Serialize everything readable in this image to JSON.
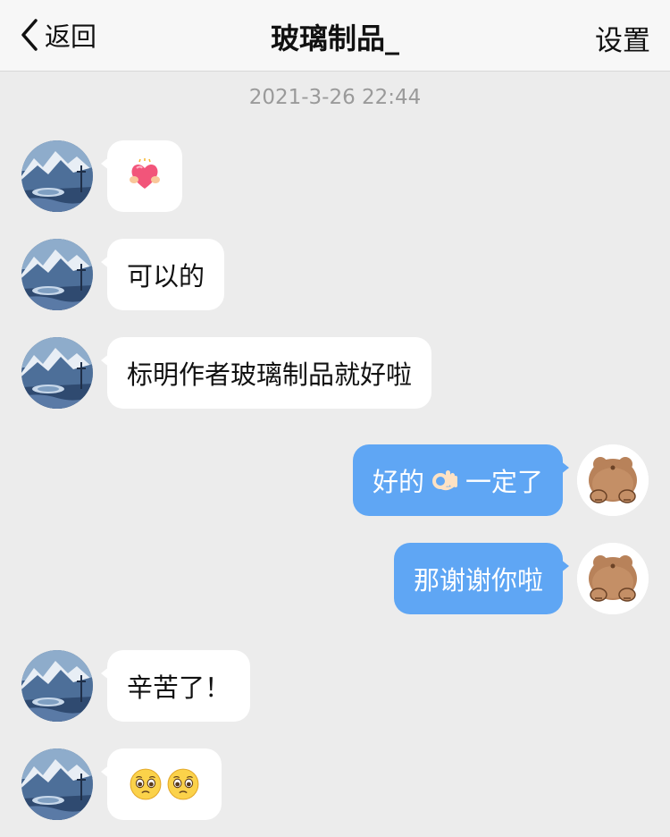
{
  "header": {
    "back_label": "返回",
    "title": "玻璃制品_",
    "settings_label": "设置"
  },
  "timestamp": "2021-3-26 22:44",
  "messages": [
    {
      "side": "in",
      "type": "emoji",
      "emoji": "heart-with-hands-sticker"
    },
    {
      "side": "in",
      "type": "text",
      "text": "可以的"
    },
    {
      "side": "in",
      "type": "text",
      "text": "标明作者玻璃制品就好啦"
    },
    {
      "side": "out",
      "type": "text",
      "text_before": "好的",
      "emoji": "ok-hand-emoji",
      "text_after": "一定了"
    },
    {
      "side": "out",
      "type": "text",
      "text": "那谢谢你啦"
    },
    {
      "side": "in",
      "type": "text",
      "text": "辛苦了！"
    },
    {
      "side": "in",
      "type": "emoji",
      "emoji": "pleading-face-emoji x2"
    }
  ],
  "colors": {
    "background": "#ececec",
    "incoming_bubble": "#ffffff",
    "outgoing_bubble": "#5fa6f4",
    "header": "#f7f7f7",
    "timestamp": "#9a9a9a"
  },
  "icons": {
    "back": "chevron-left-icon",
    "contact_avatar": "mountain-landscape-avatar",
    "user_avatar": "bear-avatar"
  }
}
